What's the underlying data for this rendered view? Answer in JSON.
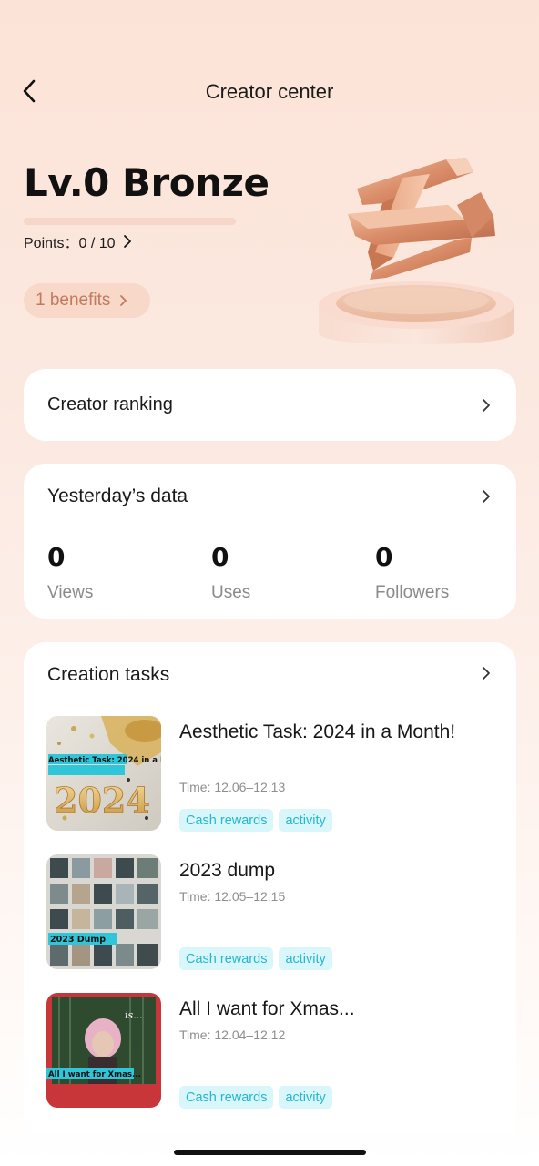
{
  "header": {
    "title": "Creator center",
    "back_icon": "chevron-left-icon"
  },
  "level": {
    "title": "Lv.0 Bronze",
    "points_label": "Points：0 / 10",
    "progress": 0,
    "benefits_label": "1 benefits"
  },
  "ranking": {
    "title": "Creator ranking"
  },
  "yesterday": {
    "title": "Yesterday’s data",
    "stats": [
      {
        "value": "0",
        "label": "Views"
      },
      {
        "value": "0",
        "label": "Uses"
      },
      {
        "value": "0",
        "label": "Followers"
      }
    ]
  },
  "tasks": {
    "title": "Creation tasks",
    "items": [
      {
        "title": "Aesthetic Task:  2024 in a Month!",
        "time": "Time: 12.06–12.13",
        "thumb_caption": "Aesthetic Task: 2024 in a Month!",
        "thumb_text": "2024",
        "tags": [
          "Cash rewards",
          "activity"
        ]
      },
      {
        "title": "2023 dump",
        "time": "Time: 12.05–12.15",
        "thumb_caption": "2023 Dump",
        "tags": [
          "Cash rewards",
          "activity"
        ]
      },
      {
        "title": "All I want for Xmas...",
        "time": "Time: 12.04–12.12",
        "thumb_caption": "All I want for Xmas...",
        "tags": [
          "Cash rewards",
          "activity"
        ]
      }
    ]
  },
  "colors": {
    "accent_tag_bg": "#d9f6fa",
    "accent_tag_text": "#25b7cf",
    "benefits_bg": "#f7d8c9",
    "benefits_text": "#c27a5f"
  }
}
